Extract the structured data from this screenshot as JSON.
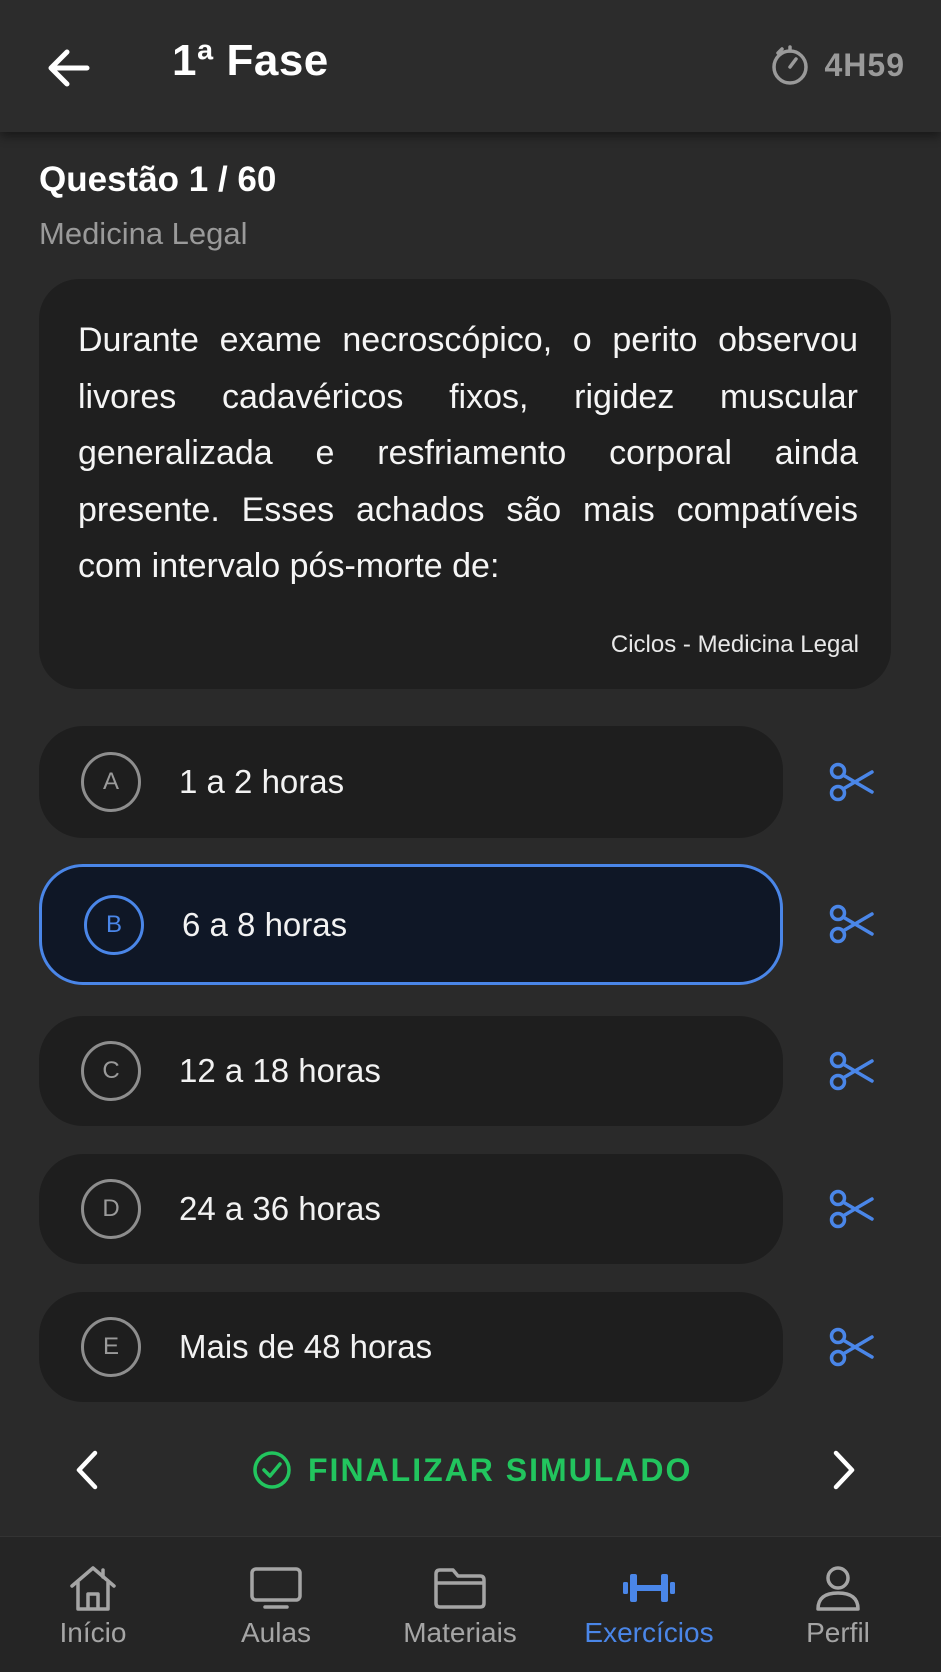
{
  "header": {
    "title": "1ª Fase",
    "timer": "4H59"
  },
  "question": {
    "number_label": "Questão 1 / 60",
    "subject": "Medicina Legal",
    "text": "Durante exame necroscópico, o perito observou livores cadavéricos fixos, rigidez muscular generalizada e resfriamento corporal ainda presente. Esses achados são mais compatíveis com intervalo pós-morte de:",
    "source": "Ciclos - Medicina Legal"
  },
  "options": [
    {
      "letter": "A",
      "text": "1 a 2 horas",
      "selected": false
    },
    {
      "letter": "B",
      "text": "6 a 8 horas",
      "selected": true
    },
    {
      "letter": "C",
      "text": "12 a 18 horas",
      "selected": false
    },
    {
      "letter": "D",
      "text": "24 a 36 horas",
      "selected": false
    },
    {
      "letter": "E",
      "text": "Mais de 48 horas",
      "selected": false
    }
  ],
  "controls": {
    "finish_label": "FINALIZAR SIMULADO"
  },
  "bottom_nav": {
    "items": [
      {
        "label": "Início",
        "icon": "home-icon",
        "active": false
      },
      {
        "label": "Aulas",
        "icon": "monitor-icon",
        "active": false
      },
      {
        "label": "Materiais",
        "icon": "folder-icon",
        "active": false
      },
      {
        "label": "Exercícios",
        "icon": "dumbbell-icon",
        "active": true
      },
      {
        "label": "Perfil",
        "icon": "user-icon",
        "active": false
      }
    ]
  },
  "colors": {
    "background": "#2a2a2a",
    "card": "#1f1f1f",
    "accent_blue": "#4a86e8",
    "success_green": "#22c55e",
    "muted_text": "#9a9a9a"
  }
}
